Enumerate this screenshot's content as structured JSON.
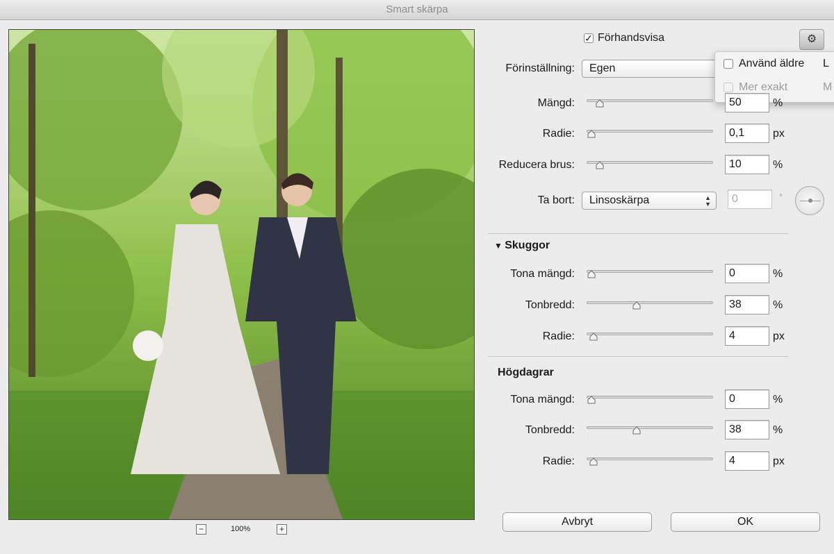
{
  "window": {
    "title": "Smart skärpa"
  },
  "zoom": {
    "minus": "−",
    "plus": "+",
    "level": "100%"
  },
  "preview_toggle": {
    "label": "Förhandsvisa",
    "checked": true,
    "check_glyph": "✓"
  },
  "gear": {
    "icon": "gear-icon",
    "glyph": "⚙"
  },
  "popup": {
    "items": [
      {
        "label": "Använd äldre",
        "shortcut": "L",
        "checked": false,
        "enabled": true
      },
      {
        "label": "Mer exakt",
        "shortcut": "M",
        "checked": false,
        "enabled": false
      }
    ]
  },
  "preset": {
    "label": "Förinställning:",
    "value": "Egen"
  },
  "main_params": [
    {
      "label": "Mängd:",
      "value": "50",
      "unit": "%",
      "slider_fraction": 0.07
    },
    {
      "label": "Radie:",
      "value": "0,1",
      "unit": "px",
      "slider_fraction": 0.0
    },
    {
      "label": "Reducera brus:",
      "value": "10",
      "unit": "%",
      "slider_fraction": 0.07
    }
  ],
  "remove": {
    "label": "Ta bort:",
    "value": "Linsoskärpa",
    "angle": "0",
    "angle_unit": "°"
  },
  "shadows": {
    "title": "Skuggor",
    "params": [
      {
        "label": "Tona mängd:",
        "value": "0",
        "unit": "%",
        "slider_fraction": 0.0
      },
      {
        "label": "Tonbredd:",
        "value": "38",
        "unit": "%",
        "slider_fraction": 0.38
      },
      {
        "label": "Radie:",
        "value": "4",
        "unit": "px",
        "slider_fraction": 0.02
      }
    ]
  },
  "highlights": {
    "title": "Högdagrar",
    "params": [
      {
        "label": "Tona mängd:",
        "value": "0",
        "unit": "%",
        "slider_fraction": 0.0
      },
      {
        "label": "Tonbredd:",
        "value": "38",
        "unit": "%",
        "slider_fraction": 0.38
      },
      {
        "label": "Radie:",
        "value": "4",
        "unit": "px",
        "slider_fraction": 0.02
      }
    ]
  },
  "buttons": {
    "cancel": "Avbryt",
    "ok": "OK"
  }
}
